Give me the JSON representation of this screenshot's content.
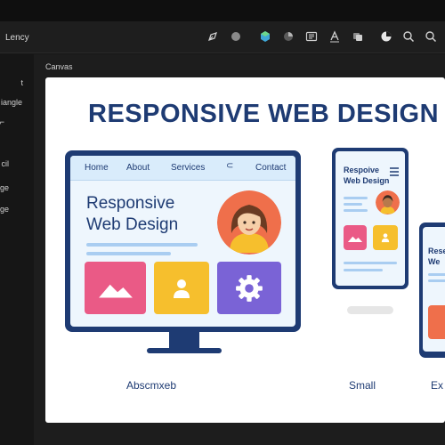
{
  "app": {
    "title": "Lency"
  },
  "toolbar": {
    "tools": [
      {
        "icon": "pen-icon"
      },
      {
        "icon": "circle-icon"
      },
      {
        "icon": "cube-icon"
      },
      {
        "icon": "fill-icon"
      },
      {
        "icon": "panel-icon"
      },
      {
        "icon": "text-icon"
      },
      {
        "icon": "layers-icon"
      },
      {
        "icon": "chart-icon"
      },
      {
        "icon": "search-icon"
      },
      {
        "icon": "zoom-icon"
      }
    ]
  },
  "sidebar": {
    "items": [
      {
        "label": "t"
      },
      {
        "label": "iangle"
      },
      {
        "label": "cil"
      },
      {
        "label": "ge"
      },
      {
        "label": "ge"
      }
    ]
  },
  "workspace": {
    "label": "Canvas"
  },
  "canvas": {
    "headline": "RESPONSIVE WEB DESIGN",
    "desktop": {
      "nav": [
        "Home",
        "About",
        "Services",
        "Contact"
      ],
      "hero_title_line1": "Responsive",
      "hero_title_line2": "Web Design",
      "label": "Abscmxeb"
    },
    "tablet": {
      "title_line1": "Respoive",
      "title_line2": "Web Design",
      "label": "Small"
    },
    "phone": {
      "title_line1": "Rese",
      "title_line2": "We",
      "label": "Ex"
    },
    "colors": {
      "navy": "#1e3b73",
      "pink": "#ea5a86",
      "yellow": "#f6bf2d",
      "purple": "#7a63d6",
      "avatar_bg": "#ef6f4b",
      "skin": "#f6cfa8",
      "hair": "#6b3b22"
    }
  }
}
